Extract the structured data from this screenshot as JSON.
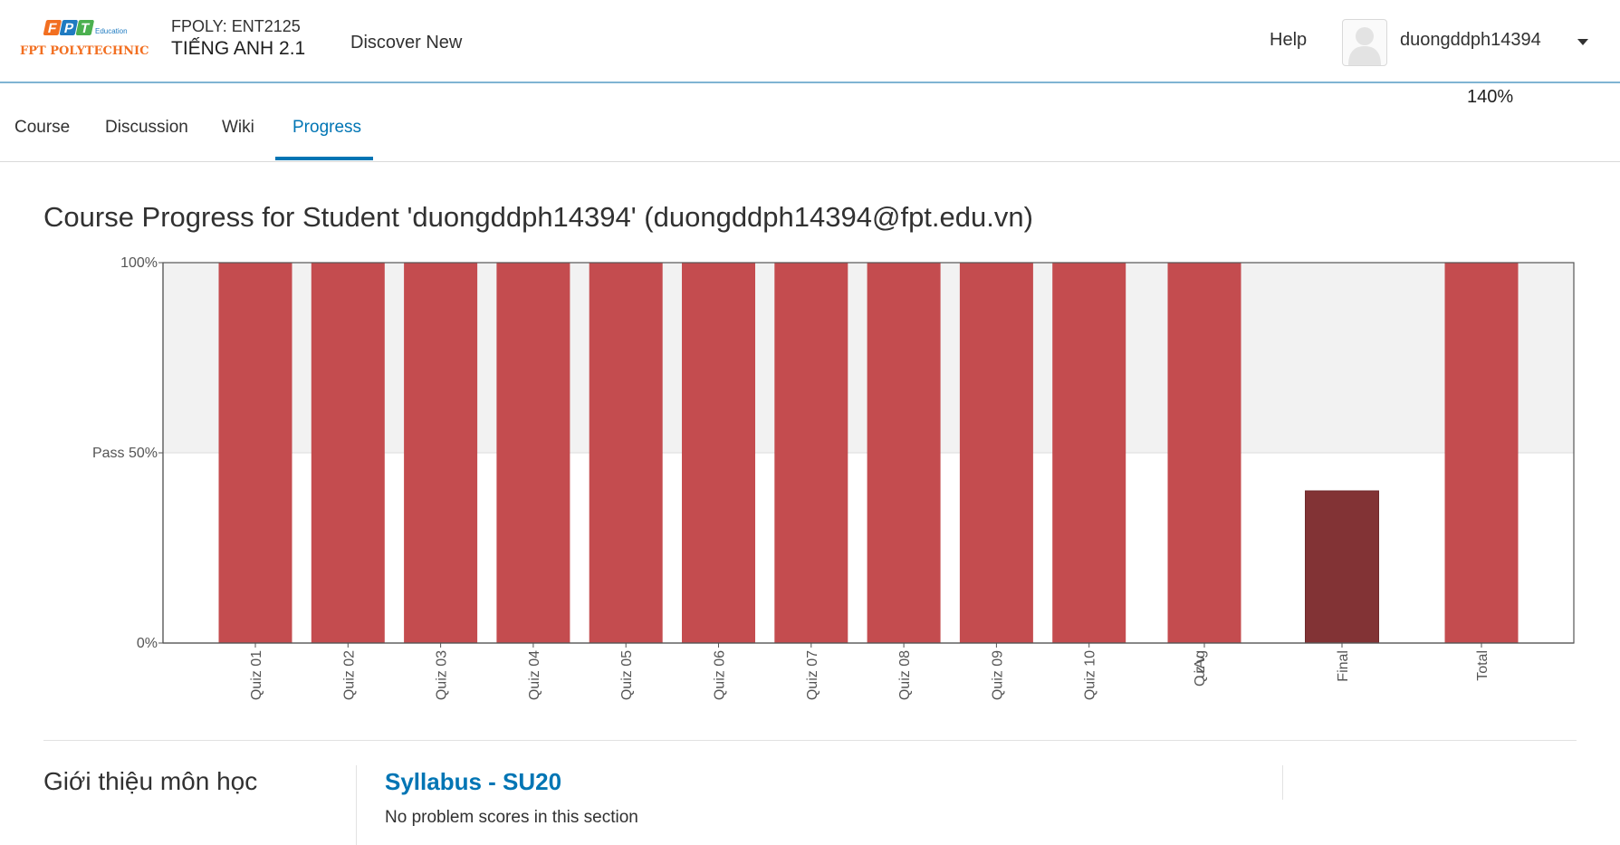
{
  "header": {
    "logo": {
      "main": "FPT POLYTECHNIC",
      "sub": "Education",
      "letters": [
        "F",
        "P",
        "T"
      ],
      "colors": {
        "f": "#f26f21",
        "p": "#1f7bc1",
        "t": "#4bb04f",
        "text": "#f26f21",
        "education": "#1f7bc1"
      }
    },
    "course_org": "FPOLY: ENT2125",
    "course_name": "TIẾNG ANH 2.1",
    "discover": "Discover New",
    "help": "Help",
    "username": "duongddph14394",
    "zoom": "140%"
  },
  "tabs": [
    {
      "label": "Course",
      "active": false
    },
    {
      "label": "Discussion",
      "active": false
    },
    {
      "label": "Wiki",
      "active": false
    },
    {
      "label": "Progress",
      "active": true
    }
  ],
  "page_title": "Course Progress for Student 'duongddph14394' (duongddph14394@fpt.edu.vn)",
  "chart_data": {
    "type": "bar",
    "categories": [
      "Quiz 01",
      "Quiz 02",
      "Quiz 03",
      "Quiz 04",
      "Quiz 05",
      "Quiz 06",
      "Quiz 07",
      "Quiz 08",
      "Quiz 09",
      "Quiz 10",
      "Quiz Avg",
      "Final",
      "Total"
    ],
    "values": [
      100,
      100,
      100,
      100,
      100,
      100,
      100,
      100,
      100,
      100,
      100,
      40,
      100
    ],
    "ylim": [
      0,
      100
    ],
    "yticks": [
      {
        "value": 0,
        "label": "0%"
      },
      {
        "value": 50,
        "label": "Pass 50%"
      },
      {
        "value": 100,
        "label": "100%"
      }
    ],
    "pass_threshold": 50,
    "colors": {
      "bar": "#c44c4f",
      "final_bar": "#823335",
      "pass_band": "#f2f2f2",
      "axis": "#555555"
    }
  },
  "section": {
    "title": "Giới thiệu môn học",
    "subsection_title": "Syllabus - SU20",
    "no_scores": "No problem scores in this section"
  }
}
